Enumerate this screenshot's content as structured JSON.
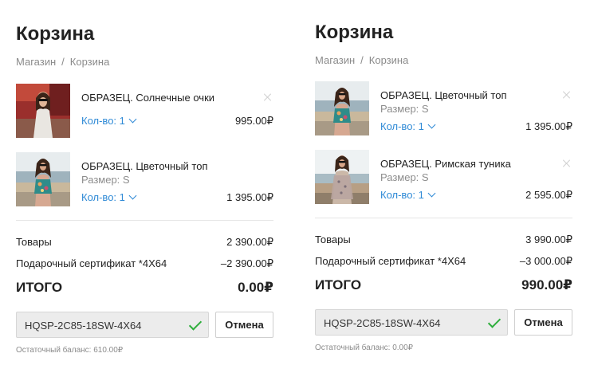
{
  "left": {
    "title": "Корзина",
    "breadcrumb": {
      "shop": "Магазин",
      "sep": "/",
      "cart": "Корзина"
    },
    "items": [
      {
        "name": "ОБРАЗЕЦ. Солнечные очки",
        "option": "",
        "qty": "Кол-во: 1",
        "price": "995.00₽",
        "thumb": "sunglasses-photo"
      },
      {
        "name": "ОБРАЗЕЦ. Цветочный топ",
        "option": "Размер: S",
        "qty": "Кол-во: 1",
        "price": "1 395.00₽",
        "thumb": "floral-top-photo"
      }
    ],
    "summary": {
      "goods_label": "Товары",
      "goods_value": "2 390.00₽",
      "cert_label": "Подарочный сертификат *4X64",
      "cert_value": "–2 390.00₽",
      "total_label": "ИТОГО",
      "total_value": "0.00₽"
    },
    "coupon": {
      "code": "HQSP-2C85-18SW-4X64",
      "cancel": "Отмена",
      "balance": "Остаточный баланс: 610.00₽"
    }
  },
  "right": {
    "title": "Корзина",
    "breadcrumb": {
      "shop": "Магазин",
      "sep": "/",
      "cart": "Корзина"
    },
    "items": [
      {
        "name": "ОБРАЗЕЦ. Цветочный топ",
        "option": "Размер: S",
        "qty": "Кол-во: 1",
        "price": "1 395.00₽",
        "thumb": "floral-top-photo"
      },
      {
        "name": "ОБРАЗЕЦ. Римская туника",
        "option": "Размер: S",
        "qty": "Кол-во: 1",
        "price": "2 595.00₽",
        "thumb": "roman-tunic-photo"
      }
    ],
    "summary": {
      "goods_label": "Товары",
      "goods_value": "3 990.00₽",
      "cert_label": "Подарочный сертификат *4X64",
      "cert_value": "–3 000.00₽",
      "total_label": "ИТОГО",
      "total_value": "990.00₽"
    },
    "coupon": {
      "code": "HQSP-2C85-18SW-4X64",
      "cancel": "Отмена",
      "balance": "Остаточный баланс: 0.00₽"
    }
  },
  "colors": {
    "accent": "#2f8ad6",
    "check": "#2eae3c",
    "muted": "#8b8b8b"
  }
}
